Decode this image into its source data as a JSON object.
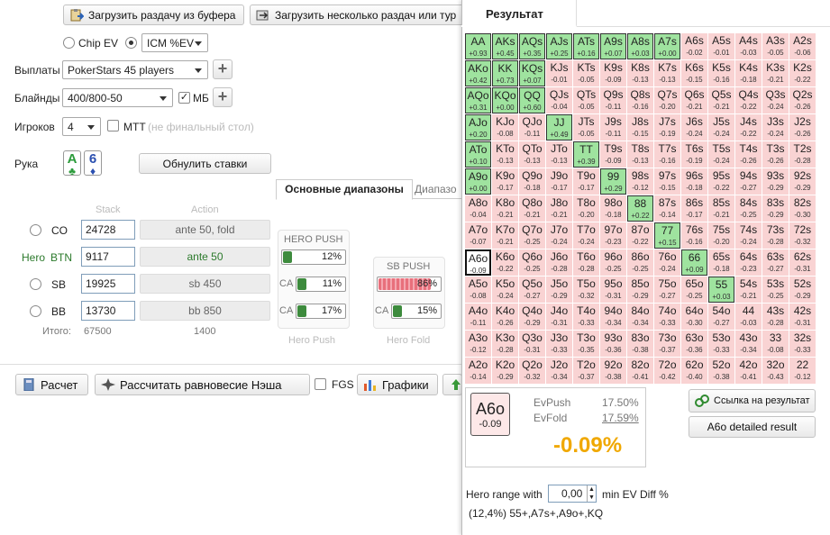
{
  "toolbar": {
    "load_buffer": "Загрузить раздачу из буфера",
    "load_many": "Загрузить несколько раздач или тур"
  },
  "model": {
    "chip_ev": "Chip EV",
    "icm": "ICM %EV"
  },
  "payouts": {
    "label": "Выплаты",
    "value": "PokerStars 45 players"
  },
  "blinds": {
    "label": "Блайнды",
    "value": "400/800-50",
    "mb": "МБ"
  },
  "players": {
    "label": "Игроков",
    "value": "4",
    "mtt": "MTT",
    "mtt_note": "(не финальный стол)"
  },
  "hand": {
    "label": "Рука",
    "card1_rank": "A",
    "card1_suit": "♣",
    "card2_rank": "6",
    "card2_suit": "♦",
    "reset": "Обнулить ставки"
  },
  "tabs": {
    "main": "Основные диапазоны",
    "other": "Диапазо"
  },
  "table": {
    "stack_hdr": "Stack",
    "action_hdr": "Action",
    "rows": [
      {
        "pos": "CO",
        "stack": "24728",
        "action": "ante 50, fold"
      },
      {
        "pos": "BTN",
        "hero": "Hero",
        "stack": "9117",
        "action": "ante 50"
      },
      {
        "pos": "SB",
        "stack": "19925",
        "action": "sb 450"
      },
      {
        "pos": "BB",
        "stack": "13730",
        "action": "bb 850"
      }
    ],
    "total_label": "Итого:",
    "total_stack": "67500",
    "total_action": "1400"
  },
  "ranges": {
    "hero_push_title": "HERO PUSH",
    "hero_push_pct": "12%",
    "hero_push_fill": 0.12,
    "sb_ca": "CA",
    "sb_ca_pct": "11%",
    "sb_ca_fill": 0.11,
    "bb_ca": "CA",
    "bb_ca_pct": "17%",
    "bb_ca_fill": 0.17,
    "sb_push_title": "SB PUSH",
    "sb_push_pct": "86%",
    "sb_push_fill": 0.86,
    "sb_push_ca": "CA",
    "sb_push_ca_pct": "15%",
    "sb_push_ca_fill": 0.15,
    "hero_push_footer": "Hero Push",
    "hero_fold_footer": "Hero Fold"
  },
  "bottom": {
    "calc": "Расчет",
    "nash": "Рассчитать равновесие Нэша",
    "fgs": "FGS",
    "charts": "Графики"
  },
  "result": {
    "title": "Результат",
    "grid": [
      [
        [
          "AA",
          "+0.93"
        ],
        [
          "AKs",
          "+0.45"
        ],
        [
          "AQs",
          "+0.35"
        ],
        [
          "AJs",
          "+0.25"
        ],
        [
          "ATs",
          "+0.16"
        ],
        [
          "A9s",
          "+0.07"
        ],
        [
          "A8s",
          "+0.03"
        ],
        [
          "A7s",
          "+0.00"
        ],
        [
          "A6s",
          "-0.02"
        ],
        [
          "A5s",
          "-0.01"
        ],
        [
          "A4s",
          "-0.03"
        ],
        [
          "A3s",
          "-0.05"
        ],
        [
          "A2s",
          "-0.06"
        ]
      ],
      [
        [
          "AKo",
          "+0.42"
        ],
        [
          "KK",
          "+0.73"
        ],
        [
          "KQs",
          "+0.07"
        ],
        [
          "KJs",
          "-0.01"
        ],
        [
          "KTs",
          "-0.05"
        ],
        [
          "K9s",
          "-0.09"
        ],
        [
          "K8s",
          "-0.13"
        ],
        [
          "K7s",
          "-0.13"
        ],
        [
          "K6s",
          "-0.15"
        ],
        [
          "K5s",
          "-0.16"
        ],
        [
          "K4s",
          "-0.18"
        ],
        [
          "K3s",
          "-0.21"
        ],
        [
          "K2s",
          "-0.22"
        ]
      ],
      [
        [
          "AQo",
          "+0.31"
        ],
        [
          "KQo",
          "+0.00"
        ],
        [
          "QQ",
          "+0.60"
        ],
        [
          "QJs",
          "-0.04"
        ],
        [
          "QTs",
          "-0.05"
        ],
        [
          "Q9s",
          "-0.11"
        ],
        [
          "Q8s",
          "-0.16"
        ],
        [
          "Q7s",
          "-0.20"
        ],
        [
          "Q6s",
          "-0.21"
        ],
        [
          "Q5s",
          "-0.21"
        ],
        [
          "Q4s",
          "-0.22"
        ],
        [
          "Q3s",
          "-0.24"
        ],
        [
          "Q2s",
          "-0.26"
        ]
      ],
      [
        [
          "AJo",
          "+0.20"
        ],
        [
          "KJo",
          "-0.08"
        ],
        [
          "QJo",
          "-0.11"
        ],
        [
          "JJ",
          "+0.49"
        ],
        [
          "JTs",
          "-0.05"
        ],
        [
          "J9s",
          "-0.11"
        ],
        [
          "J8s",
          "-0.15"
        ],
        [
          "J7s",
          "-0.19"
        ],
        [
          "J6s",
          "-0.24"
        ],
        [
          "J5s",
          "-0.24"
        ],
        [
          "J4s",
          "-0.22"
        ],
        [
          "J3s",
          "-0.24"
        ],
        [
          "J2s",
          "-0.26"
        ]
      ],
      [
        [
          "ATo",
          "+0.10"
        ],
        [
          "KTo",
          "-0.13"
        ],
        [
          "QTo",
          "-0.13"
        ],
        [
          "JTo",
          "-0.13"
        ],
        [
          "TT",
          "+0.39"
        ],
        [
          "T9s",
          "-0.09"
        ],
        [
          "T8s",
          "-0.13"
        ],
        [
          "T7s",
          "-0.16"
        ],
        [
          "T6s",
          "-0.19"
        ],
        [
          "T5s",
          "-0.24"
        ],
        [
          "T4s",
          "-0.26"
        ],
        [
          "T3s",
          "-0.26"
        ],
        [
          "T2s",
          "-0.28"
        ]
      ],
      [
        [
          "A9o",
          "+0.00"
        ],
        [
          "K9o",
          "-0.17"
        ],
        [
          "Q9o",
          "-0.18"
        ],
        [
          "J9o",
          "-0.17"
        ],
        [
          "T9o",
          "-0.17"
        ],
        [
          "99",
          "+0.29"
        ],
        [
          "98s",
          "-0.12"
        ],
        [
          "97s",
          "-0.15"
        ],
        [
          "96s",
          "-0.18"
        ],
        [
          "95s",
          "-0.22"
        ],
        [
          "94s",
          "-0.27"
        ],
        [
          "93s",
          "-0.29"
        ],
        [
          "92s",
          "-0.29"
        ]
      ],
      [
        [
          "A8o",
          "-0.04"
        ],
        [
          "K8o",
          "-0.21"
        ],
        [
          "Q8o",
          "-0.21"
        ],
        [
          "J8o",
          "-0.21"
        ],
        [
          "T8o",
          "-0.20"
        ],
        [
          "98o",
          "-0.18"
        ],
        [
          "88",
          "+0.22"
        ],
        [
          "87s",
          "-0.14"
        ],
        [
          "86s",
          "-0.17"
        ],
        [
          "85s",
          "-0.21"
        ],
        [
          "84s",
          "-0.25"
        ],
        [
          "83s",
          "-0.29"
        ],
        [
          "82s",
          "-0.30"
        ]
      ],
      [
        [
          "A7o",
          "-0.07"
        ],
        [
          "K7o",
          "-0.21"
        ],
        [
          "Q7o",
          "-0.25"
        ],
        [
          "J7o",
          "-0.24"
        ],
        [
          "T7o",
          "-0.24"
        ],
        [
          "97o",
          "-0.23"
        ],
        [
          "87o",
          "-0.22"
        ],
        [
          "77",
          "+0.15"
        ],
        [
          "76s",
          "-0.16"
        ],
        [
          "75s",
          "-0.20"
        ],
        [
          "74s",
          "-0.24"
        ],
        [
          "73s",
          "-0.28"
        ],
        [
          "72s",
          "-0.32"
        ]
      ],
      [
        [
          "A6o",
          "-0.09"
        ],
        [
          "K6o",
          "-0.22"
        ],
        [
          "Q6o",
          "-0.25"
        ],
        [
          "J6o",
          "-0.28"
        ],
        [
          "T6o",
          "-0.28"
        ],
        [
          "96o",
          "-0.25"
        ],
        [
          "86o",
          "-0.25"
        ],
        [
          "76o",
          "-0.24"
        ],
        [
          "66",
          "+0.09"
        ],
        [
          "65s",
          "-0.18"
        ],
        [
          "64s",
          "-0.23"
        ],
        [
          "63s",
          "-0.27"
        ],
        [
          "62s",
          "-0.31"
        ]
      ],
      [
        [
          "A5o",
          "-0.08"
        ],
        [
          "K5o",
          "-0.24"
        ],
        [
          "Q5o",
          "-0.27"
        ],
        [
          "J5o",
          "-0.29"
        ],
        [
          "T5o",
          "-0.32"
        ],
        [
          "95o",
          "-0.31"
        ],
        [
          "85o",
          "-0.29"
        ],
        [
          "75o",
          "-0.27"
        ],
        [
          "65o",
          "-0.25"
        ],
        [
          "55",
          "+0.03"
        ],
        [
          "54s",
          "-0.21"
        ],
        [
          "53s",
          "-0.25"
        ],
        [
          "52s",
          "-0.29"
        ]
      ],
      [
        [
          "A4o",
          "-0.11"
        ],
        [
          "K4o",
          "-0.26"
        ],
        [
          "Q4o",
          "-0.29"
        ],
        [
          "J4o",
          "-0.31"
        ],
        [
          "T4o",
          "-0.33"
        ],
        [
          "94o",
          "-0.34"
        ],
        [
          "84o",
          "-0.34"
        ],
        [
          "74o",
          "-0.33"
        ],
        [
          "64o",
          "-0.30"
        ],
        [
          "54o",
          "-0.27"
        ],
        [
          "44",
          "-0.03"
        ],
        [
          "43s",
          "-0.28"
        ],
        [
          "42s",
          "-0.31"
        ]
      ],
      [
        [
          "A3o",
          "-0.12"
        ],
        [
          "K3o",
          "-0.28"
        ],
        [
          "Q3o",
          "-0.31"
        ],
        [
          "J3o",
          "-0.33"
        ],
        [
          "T3o",
          "-0.35"
        ],
        [
          "93o",
          "-0.36"
        ],
        [
          "83o",
          "-0.38"
        ],
        [
          "73o",
          "-0.37"
        ],
        [
          "63o",
          "-0.36"
        ],
        [
          "53o",
          "-0.33"
        ],
        [
          "43o",
          "-0.34"
        ],
        [
          "33",
          "-0.08"
        ],
        [
          "32s",
          "-0.33"
        ]
      ],
      [
        [
          "A2o",
          "-0.14"
        ],
        [
          "K2o",
          "-0.29"
        ],
        [
          "Q2o",
          "-0.32"
        ],
        [
          "J2o",
          "-0.34"
        ],
        [
          "T2o",
          "-0.37"
        ],
        [
          "92o",
          "-0.38"
        ],
        [
          "82o",
          "-0.41"
        ],
        [
          "72o",
          "-0.42"
        ],
        [
          "62o",
          "-0.40"
        ],
        [
          "52o",
          "-0.38"
        ],
        [
          "42o",
          "-0.41"
        ],
        [
          "32o",
          "-0.43"
        ],
        [
          "22",
          "-0.12"
        ]
      ]
    ],
    "detail": {
      "hand": "A6o",
      "ev": "-0.09",
      "evpush_label": "EvPush",
      "evpush": "17.50%",
      "evfold_label": "EvFold",
      "evfold": "17.59%",
      "diff": "-0.09%"
    },
    "link_btn": "Ссылка на результат",
    "detail_btn": "A6o detailed result",
    "hero_range_label": "Hero range with",
    "hero_range_value": "0,00",
    "hero_range_suffix": "min EV Diff %",
    "hero_range_summary": "(12,4%) 55+,A7s+,A9o+,KQ"
  }
}
